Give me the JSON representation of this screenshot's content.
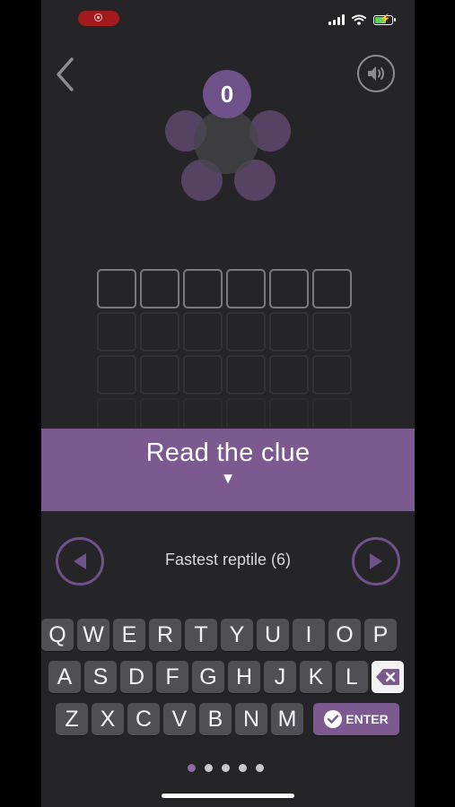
{
  "status_bar": {
    "battery_level": 0.7
  },
  "score": "0",
  "clue_banner": {
    "title": "Read the clue",
    "arrow": "▼"
  },
  "clue": {
    "text": "Fastest reptile (6)"
  },
  "keyboard": {
    "row1": [
      "Q",
      "W",
      "E",
      "R",
      "T",
      "Y",
      "U",
      "I",
      "O",
      "P"
    ],
    "row2": [
      "A",
      "S",
      "D",
      "F",
      "G",
      "H",
      "J",
      "K",
      "L"
    ],
    "row3": [
      "Z",
      "X",
      "C",
      "V",
      "B",
      "N",
      "M"
    ],
    "enter_label": "ENTER"
  },
  "pager": {
    "count": 5,
    "active_index": 0
  },
  "colors": {
    "accent": "#7c5a8f",
    "background": "#252427",
    "key": "#505054"
  },
  "icons": [
    "back-chevron-icon",
    "speaker-icon",
    "prev-arrow-icon",
    "next-arrow-icon",
    "backspace-icon",
    "check-icon"
  ]
}
